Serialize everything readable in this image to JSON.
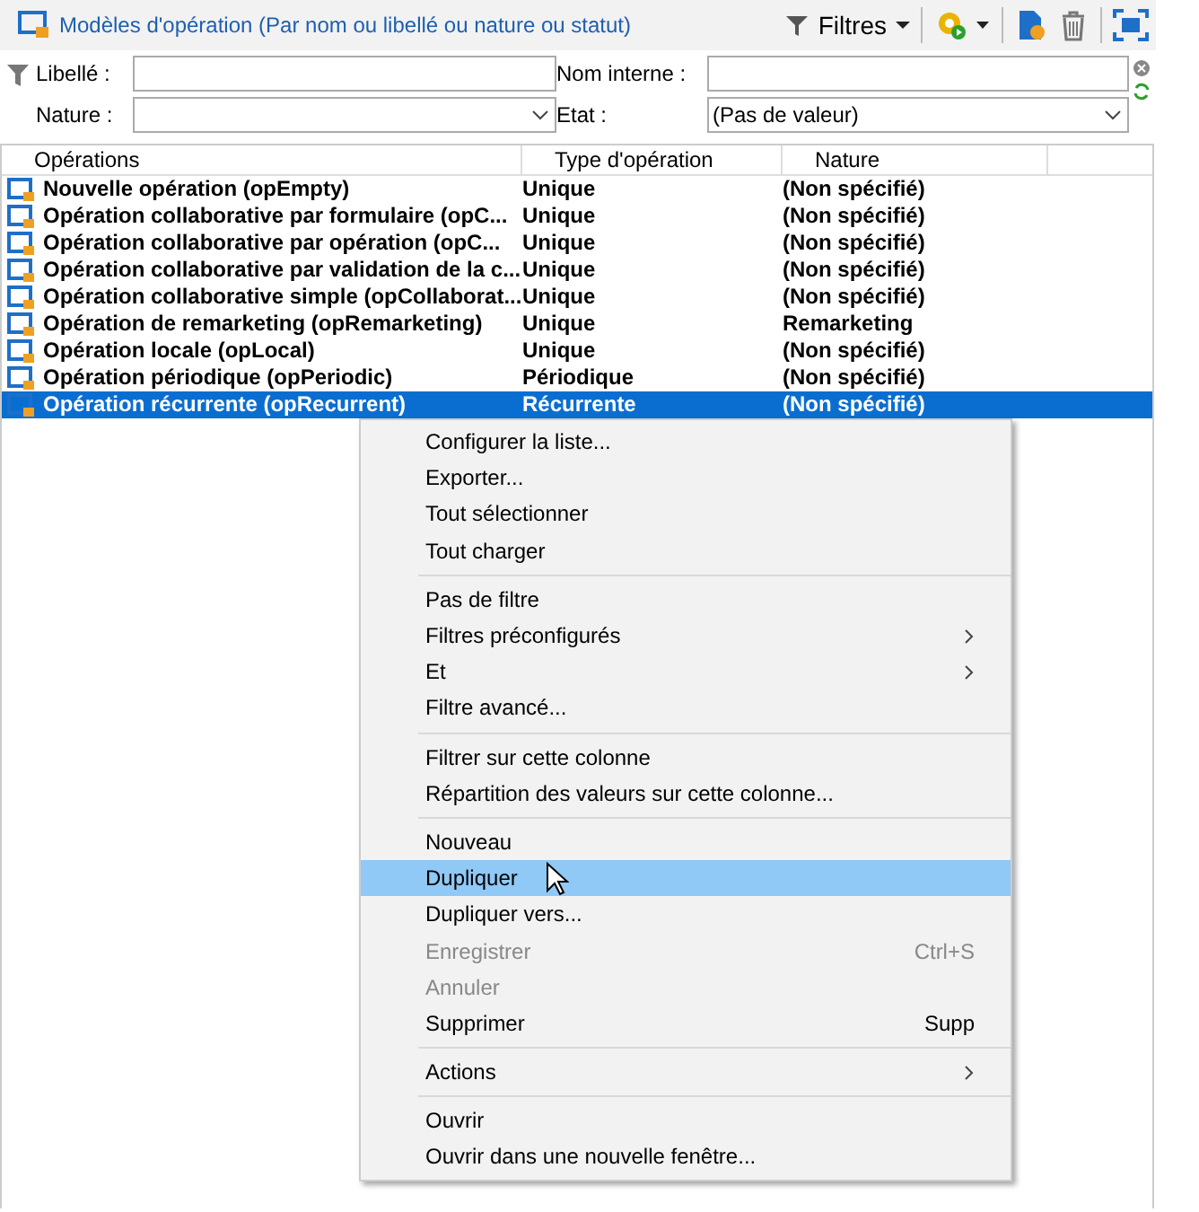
{
  "header": {
    "title": "Modèles d'opération (Par nom ou libellé ou nature ou statut)",
    "filters_button": "Filtres"
  },
  "filters": {
    "libelle_label": "Libellé :",
    "nom_interne_label": "Nom interne :",
    "nature_label": "Nature :",
    "etat_label": "Etat :",
    "etat_value": "(Pas de valeur)"
  },
  "table": {
    "columns": [
      "Opérations",
      "Type d'opération",
      "Nature"
    ],
    "rows": [
      {
        "cells": [
          "Nouvelle opération (opEmpty)",
          "Unique",
          "(Non spécifié)"
        ],
        "selected": false
      },
      {
        "cells": [
          "Opération collaborative par formulaire (opC...",
          "Unique",
          "(Non spécifié)"
        ],
        "selected": false
      },
      {
        "cells": [
          "Opération collaborative par opération (opC...",
          "Unique",
          "(Non spécifié)"
        ],
        "selected": false
      },
      {
        "cells": [
          "Opération collaborative par validation de la c...",
          "Unique",
          "(Non spécifié)"
        ],
        "selected": false
      },
      {
        "cells": [
          "Opération collaborative simple (opCollaborat...",
          "Unique",
          "(Non spécifié)"
        ],
        "selected": false
      },
      {
        "cells": [
          "Opération de remarketing (opRemarketing)",
          "Unique",
          "Remarketing"
        ],
        "selected": false
      },
      {
        "cells": [
          "Opération locale (opLocal)",
          "Unique",
          "(Non spécifié)"
        ],
        "selected": false
      },
      {
        "cells": [
          "Opération périodique (opPeriodic)",
          "Périodique",
          "(Non spécifié)"
        ],
        "selected": false
      },
      {
        "cells": [
          "Opération récurrente (opRecurrent)",
          "Récurrente",
          "(Non spécifié)"
        ],
        "selected": true
      }
    ]
  },
  "context_menu": {
    "groups": [
      [
        {
          "label": "Configurer la liste...",
          "selected": false,
          "disabled": false,
          "submenu": false
        },
        {
          "label": "Exporter...",
          "selected": false,
          "disabled": false,
          "submenu": false
        },
        {
          "label": "Tout sélectionner",
          "selected": false,
          "disabled": false,
          "submenu": false
        },
        {
          "label": "Tout charger",
          "selected": false,
          "disabled": false,
          "submenu": false
        }
      ],
      [
        {
          "label": "Pas de filtre",
          "selected": false,
          "disabled": false,
          "submenu": false
        },
        {
          "label": "Filtres préconfigurés",
          "selected": false,
          "disabled": false,
          "submenu": true
        },
        {
          "label": "Et",
          "selected": false,
          "disabled": false,
          "submenu": true
        },
        {
          "label": "Filtre avancé...",
          "selected": false,
          "disabled": false,
          "submenu": false
        }
      ],
      [
        {
          "label": "Filtrer sur cette colonne",
          "selected": false,
          "disabled": false,
          "submenu": false
        },
        {
          "label": "Répartition des valeurs sur cette colonne...",
          "selected": false,
          "disabled": false,
          "submenu": false
        }
      ],
      [
        {
          "label": "Nouveau",
          "selected": false,
          "disabled": false,
          "submenu": false
        },
        {
          "label": "Dupliquer",
          "selected": true,
          "disabled": false,
          "submenu": false
        },
        {
          "label": "Dupliquer vers...",
          "selected": false,
          "disabled": false,
          "submenu": false
        },
        {
          "label": "Enregistrer",
          "shortcut": "Ctrl+S",
          "selected": false,
          "disabled": true,
          "submenu": false
        },
        {
          "label": "Annuler",
          "selected": false,
          "disabled": true,
          "submenu": false
        },
        {
          "label": "Supprimer",
          "shortcut": "Supp",
          "selected": false,
          "disabled": false,
          "submenu": false
        }
      ],
      [
        {
          "label": "Actions",
          "selected": false,
          "disabled": false,
          "submenu": true
        }
      ],
      [
        {
          "label": "Ouvrir",
          "selected": false,
          "disabled": false,
          "submenu": false
        },
        {
          "label": "Ouvrir dans une nouvelle fenêtre...",
          "selected": false,
          "disabled": false,
          "submenu": false
        }
      ]
    ]
  }
}
